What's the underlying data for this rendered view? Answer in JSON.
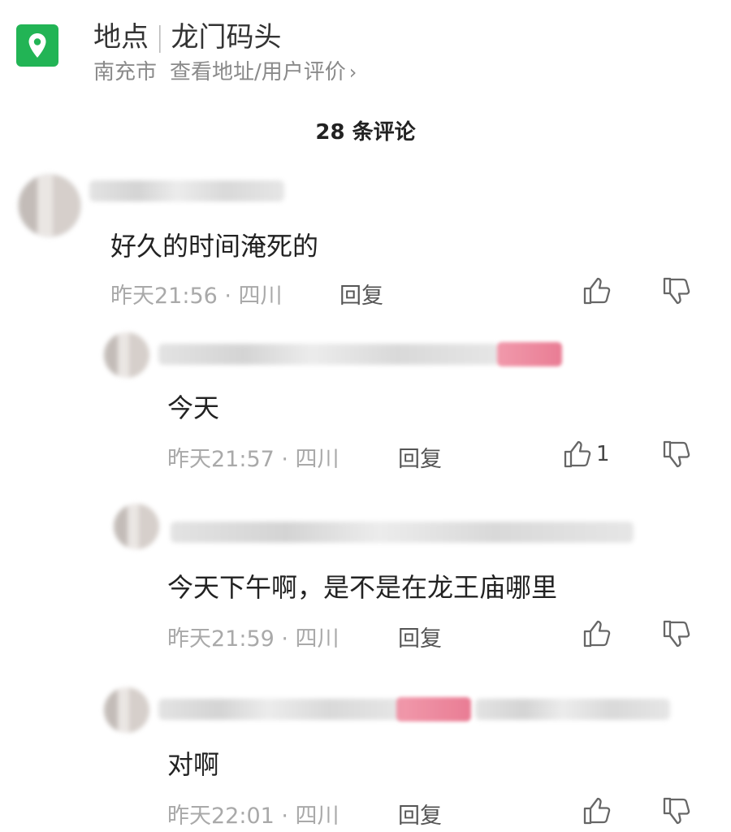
{
  "location": {
    "label": "地点",
    "place": "龙门码头",
    "city": "南充市",
    "link": "查看地址/用户评价",
    "chevron": "›",
    "icon": "location-pin-icon",
    "accent": "#22b455"
  },
  "comment_count": "28 条评论",
  "comments": [
    {
      "text": "好久的时间淹死的",
      "meta": "昨天21:56 · 四川",
      "reply": "回复",
      "likes": ""
    },
    {
      "text": "今天",
      "meta": "昨天21:57 · 四川",
      "reply": "回复",
      "likes": "1"
    },
    {
      "text": "今天下午啊，是不是在龙王庙哪里",
      "meta": "昨天21:59 · 四川",
      "reply": "回复",
      "likes": ""
    },
    {
      "text": "对啊",
      "meta": "昨天22:01 · 四川",
      "reply": "回复",
      "likes": ""
    }
  ]
}
